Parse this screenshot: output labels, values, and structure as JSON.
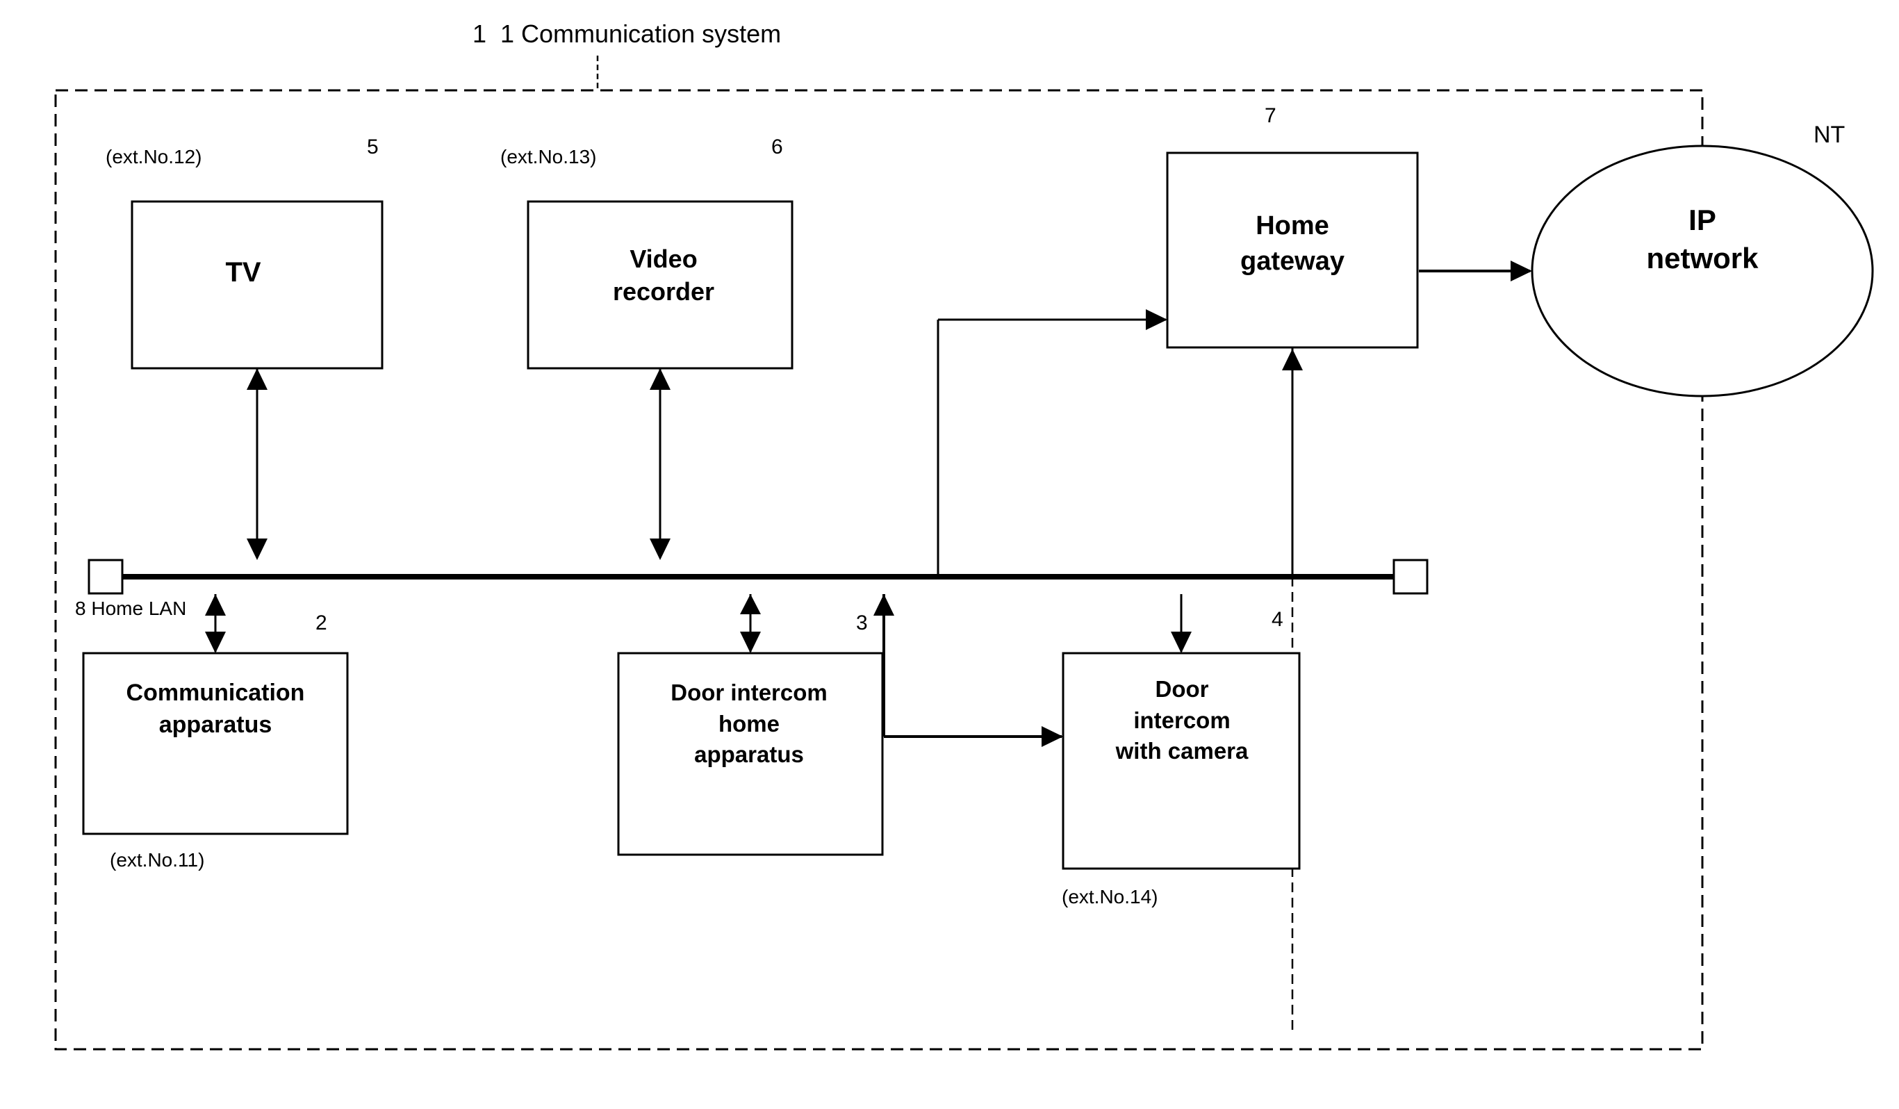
{
  "title": "Communication system",
  "title_number": "1",
  "nodes": {
    "tv": {
      "label": "TV",
      "ext": "(ext.No.12)",
      "number": "5"
    },
    "video_recorder": {
      "label": "Video\nrecorder",
      "ext": "(ext.No.13)",
      "number": "6"
    },
    "home_gateway": {
      "label": "Home\ngateway",
      "number": "7"
    },
    "ip_network": {
      "label": "IP\nnetwork",
      "annotation": "NT"
    },
    "communication_apparatus": {
      "label": "Communication\napparatus",
      "ext": "(ext.No.11)",
      "number": "2"
    },
    "door_intercom_home": {
      "label": "Door intercom\nhome\napparatus",
      "number": "3"
    },
    "door_intercom_camera": {
      "label": "Door\nintercom\nwith camera",
      "ext": "(ext.No.14)",
      "number": "4"
    },
    "home_lan": {
      "label": "8 Home LAN"
    }
  },
  "colors": {
    "line": "#000000",
    "box_border": "#000000",
    "dashed_border": "#000000",
    "background": "#ffffff"
  }
}
